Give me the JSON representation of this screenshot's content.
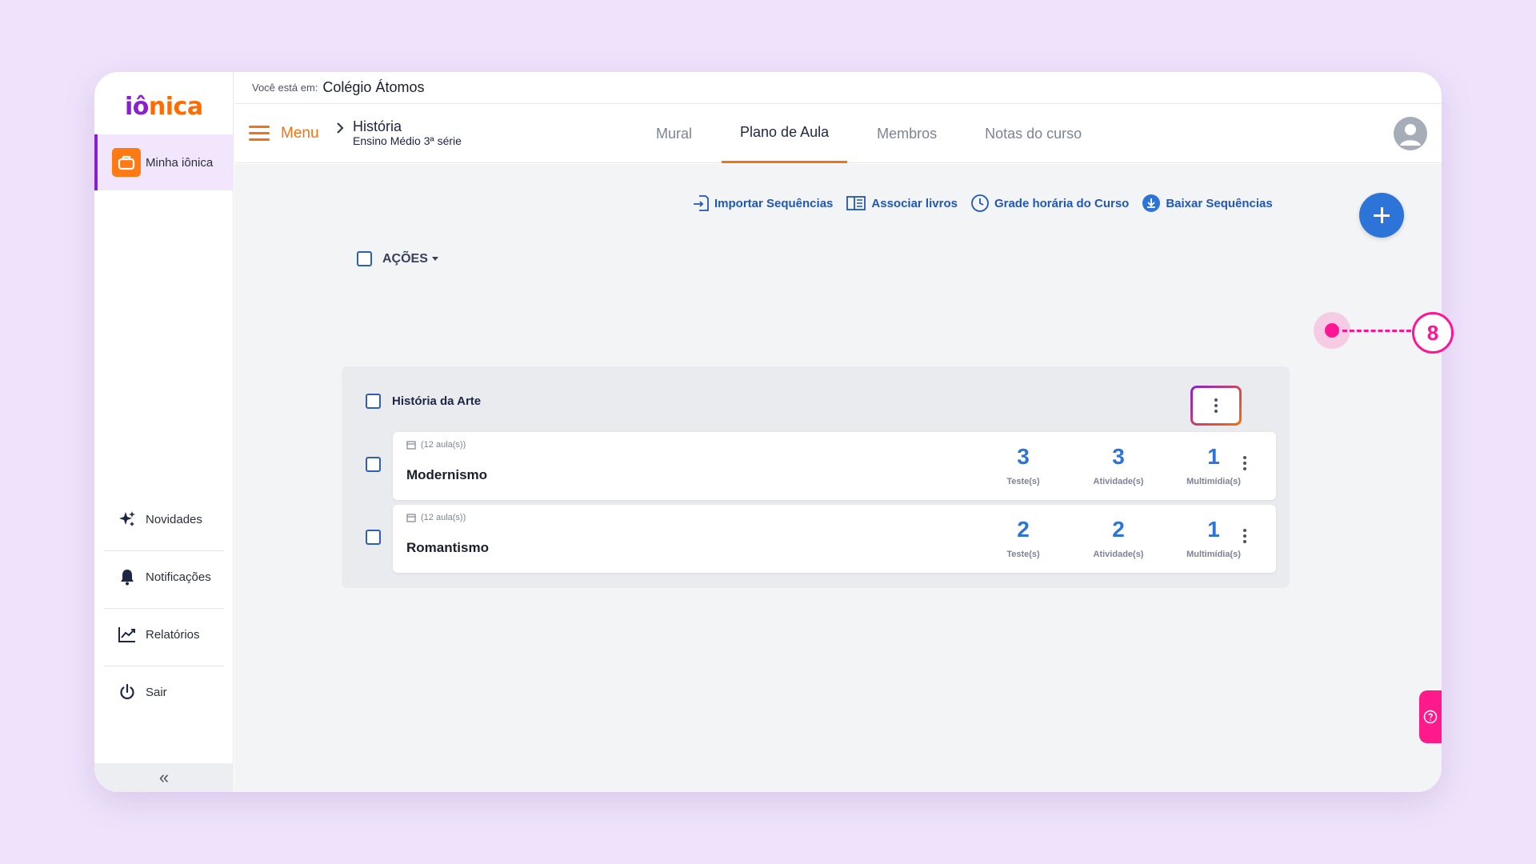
{
  "brand": {
    "logo_part1": "iô",
    "logo_part2": "nica"
  },
  "sidebar": {
    "active_item": {
      "label": "Minha iônica",
      "icon": "suitcase-icon"
    },
    "bottom_items": [
      {
        "label": "Novidades",
        "icon": "sparkle-icon"
      },
      {
        "label": "Notificações",
        "icon": "bell-icon"
      },
      {
        "label": "Relatórios",
        "icon": "chart-icon"
      },
      {
        "label": "Sair",
        "icon": "power-icon"
      }
    ],
    "collapse_glyph": "«"
  },
  "topbar": {
    "prefix": "Você está em:",
    "school": "Colégio Átomos"
  },
  "nav": {
    "menu_label": "Menu",
    "breadcrumb_title": "História",
    "breadcrumb_subtitle": "Ensino Médio 3ª série",
    "tabs": [
      "Mural",
      "Plano de Aula",
      "Membros",
      "Notas do curso"
    ],
    "active_tab": "Plano de Aula"
  },
  "toolbar": {
    "import_label": "Importar Sequências",
    "associate_label": "Associar livros",
    "schedule_label": "Grade horária do Curso",
    "download_label": "Baixar Sequências"
  },
  "actions": {
    "label": "AÇÕES"
  },
  "group": {
    "name": "História da Arte",
    "sequences": [
      {
        "lessons": "(12 aula(s))",
        "title": "Modernismo",
        "tests": "3",
        "tests_label": "Teste(s)",
        "activities": "3",
        "activities_label": "Atividade(s)",
        "multimedia": "1",
        "multimedia_label": "Multimídia(s)"
      },
      {
        "lessons": "(12 aula(s))",
        "title": "Romantismo",
        "tests": "2",
        "tests_label": "Teste(s)",
        "activities": "2",
        "activities_label": "Atividade(s)",
        "multimedia": "1",
        "multimedia_label": "Multimídia(s)"
      }
    ]
  },
  "annotation": {
    "number": "8"
  },
  "colors": {
    "brand_purple": "#8a1fd0",
    "brand_orange": "#ff6b00",
    "link_blue": "#2057b8",
    "annotation_pink": "#ff1493"
  }
}
